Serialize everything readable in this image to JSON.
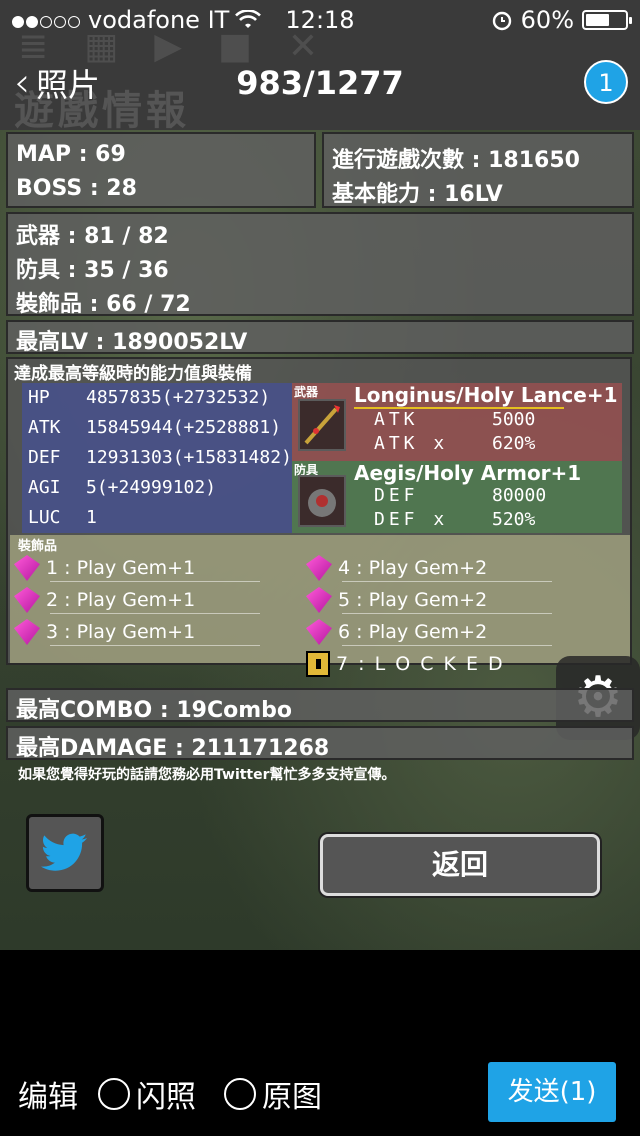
{
  "status_bar": {
    "carrier": "vodafone IT",
    "signal_dots_filled": 2,
    "signal_dots_total": 5,
    "time": "12:18",
    "battery_percent": "60%",
    "battery_level": 0.6
  },
  "nav": {
    "back_label": "照片",
    "title": "983/1277",
    "badge_count": "1"
  },
  "game_header": {
    "title": "遊戲情報"
  },
  "info": {
    "map": "MAP : 69",
    "boss": "BOSS : 28",
    "plays": "進行遊戲次數 : 181650",
    "base_ability": "基本能力 : 16LV",
    "weapons": "武器 : 81 / 82",
    "armor": "防具 : 35 / 36",
    "accessories": "裝飾品 : 66 / 72",
    "max_lv": "最高LV : 1890052LV",
    "max_combo": "最高COMBO : 19Combo",
    "max_damage": "最高DAMAGE : 211171268"
  },
  "stats": {
    "title": "達成最高等級時的能力值與裝備",
    "rows": [
      {
        "key": "HP",
        "value": "4857835(+2732532)"
      },
      {
        "key": "ATK",
        "value": "15845944(+2528881)"
      },
      {
        "key": "DEF",
        "value": "12931303(+15831482)"
      },
      {
        "key": "AGI",
        "value": "5(+24999102)"
      },
      {
        "key": "LUC",
        "value": "1"
      }
    ],
    "weapon": {
      "tag": "武器",
      "name": "Longinus/Holy Lance+1",
      "stat1_key": "ATK",
      "stat1_value": "5000",
      "stat2_key": "ATK x",
      "stat2_value": "620%"
    },
    "armor": {
      "tag": "防具",
      "name": "Aegis/Holy Armor+1",
      "stat1_key": "DEF",
      "stat1_value": "80000",
      "stat2_key": "DEF x",
      "stat2_value": "520%"
    },
    "accessories": {
      "title": "裝飾品",
      "items": [
        "1 : Play Gem+1",
        "2 : Play Gem+1",
        "3 : Play Gem+1",
        "4 : Play Gem+2",
        "5 : Play Gem+2",
        "6 : Play Gem+2",
        "7 : L O C K E D"
      ]
    }
  },
  "note": "如果您覺得好玩的話請您務必用Twitter幫忙多多支持宣傳。",
  "buttons": {
    "return": "返回"
  },
  "bottom_bar": {
    "edit": "编辑",
    "flash": "闪照",
    "original": "原图",
    "send": "发送(1)"
  },
  "colors": {
    "accent": "#1fa3e6",
    "stats_blue": "#4650a0",
    "weapon_red": "#a05050",
    "armor_green": "#508250",
    "gem_pink": "#ff5ad8"
  }
}
